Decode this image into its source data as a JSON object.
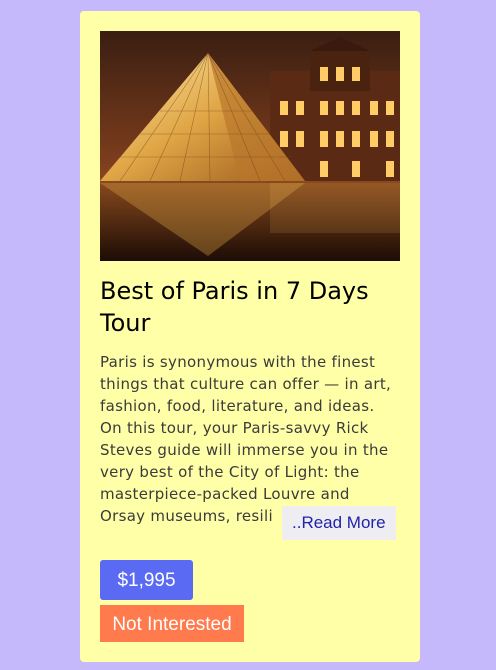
{
  "tour": {
    "image_alt": "Louvre pyramid lit at night",
    "title": "Best of Paris in 7 Days Tour",
    "description": "Paris is synonymous with the finest things that culture can offer — in art, fashion, food, literature, and ideas. On this tour, your Paris-savvy Rick Steves guide will immerse you in the very best of the City of Light: the masterpiece-packed Louvre and Orsay museums, resili",
    "read_more_label": "..Read More",
    "price_label": "$1,995",
    "not_interested_label": "Not Interested"
  },
  "colors": {
    "background": "#c5b8fb",
    "card": "#ffffa8",
    "price_button": "#5a6af2",
    "not_interested_button": "#ff7a4d",
    "read_more_text": "#2222aa"
  }
}
